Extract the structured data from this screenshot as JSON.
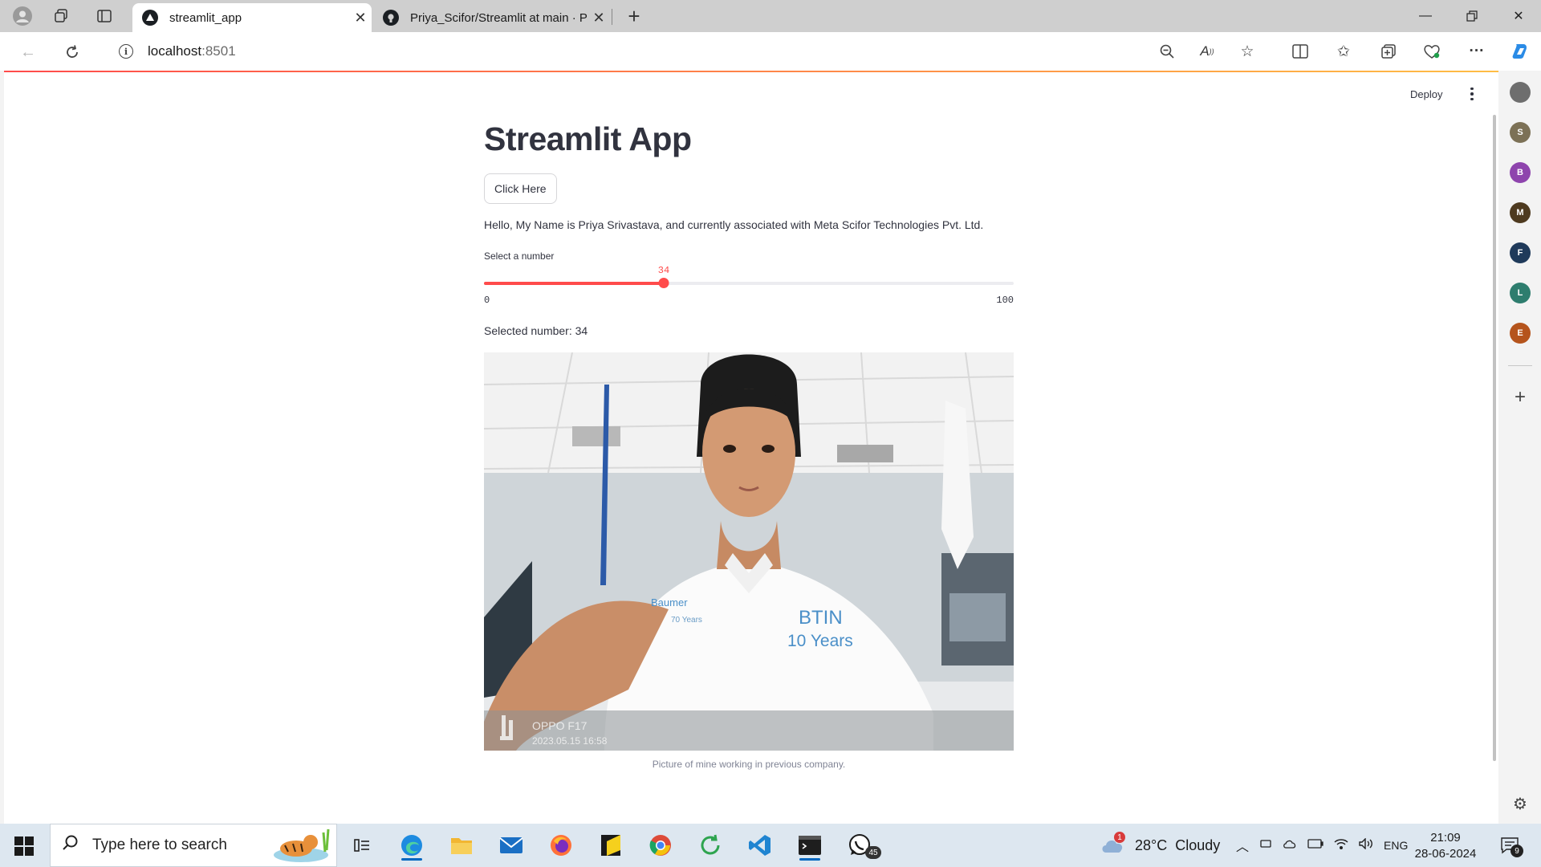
{
  "browser": {
    "tabs": [
      {
        "label": "streamlit_app",
        "active": true
      },
      {
        "label": "Priya_Scifor/Streamlit at main · Pr",
        "active": false
      }
    ],
    "url_host": "localhost",
    "url_port": ":8501"
  },
  "streamlit": {
    "deploy_label": "Deploy",
    "title": "Streamlit App",
    "button_label": "Click Here",
    "intro_text": "Hello, My Name is Priya Srivastava, and currently associated with Meta Scifor Technologies Pvt. Ltd.",
    "slider": {
      "label": "Select a number",
      "value": 34,
      "value_text": "34",
      "min": 0,
      "max": 100,
      "min_text": "0",
      "max_text": "100"
    },
    "selected_text": "Selected number: 34",
    "image_caption": "Picture of mine working in previous company.",
    "photo_overlay": {
      "shirt_brand": "Baumer",
      "shirt_sub": "70 Years",
      "shirt_btin": "BTIN",
      "shirt_years": "10 Years",
      "camera_model": "OPPO F17",
      "camera_timestamp": "2023.05.15 16:58"
    }
  },
  "sidebar": {
    "avatars": [
      {
        "letter": "",
        "color": "#6e6e6e"
      },
      {
        "letter": "S",
        "color": "#7c7156"
      },
      {
        "letter": "B",
        "color": "#8e44ad"
      },
      {
        "letter": "M",
        "color": "#4e3a1f"
      },
      {
        "letter": "F",
        "color": "#1f3a5a"
      },
      {
        "letter": "L",
        "color": "#2e7d6e"
      },
      {
        "letter": "E",
        "color": "#b5541c"
      }
    ]
  },
  "taskbar": {
    "search_placeholder": "Type here to search",
    "whatsapp_badge": "45",
    "weather_badge": "1",
    "weather_text": "28°C  Cloudy",
    "language": "ENG",
    "time": "21:09",
    "date": "28-06-2024",
    "notification_count": "9"
  },
  "colors": {
    "accent": "#ff4b4b",
    "text": "#31333f",
    "caption": "#808495"
  }
}
